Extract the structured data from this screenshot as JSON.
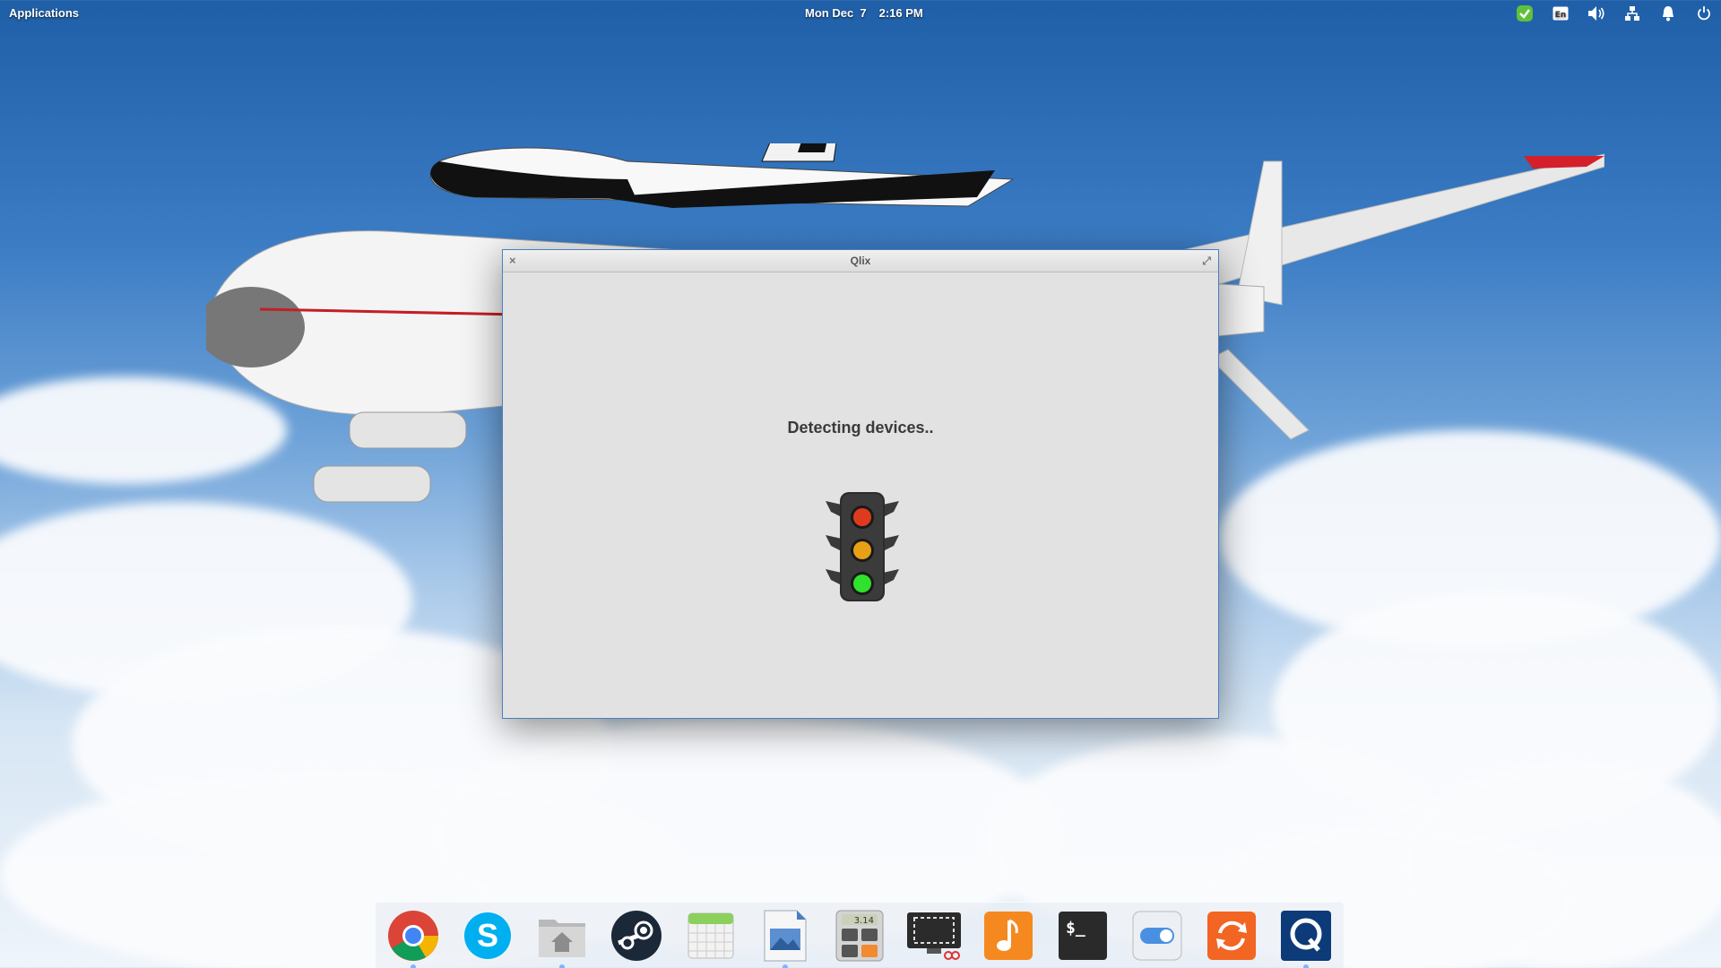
{
  "panel": {
    "applications_label": "Applications",
    "date": "Mon Dec  7",
    "time": "2:16 PM",
    "indicators": [
      "shield-check-icon",
      "keyboard-layout-icon",
      "volume-icon",
      "network-icon",
      "notifications-icon",
      "power-icon"
    ],
    "keyboard_layout": "En"
  },
  "window": {
    "title": "Qlix",
    "close_glyph": "×",
    "maximize_glyph": "⤢",
    "status_text": "Detecting devices..",
    "traffic_light_icon": "traffic-light-icon"
  },
  "dock": {
    "items": [
      {
        "name": "chrome",
        "icon": "chrome-icon",
        "running": true
      },
      {
        "name": "skype",
        "icon": "skype-icon",
        "running": false
      },
      {
        "name": "files",
        "icon": "home-folder-icon",
        "running": true
      },
      {
        "name": "steam",
        "icon": "steam-icon",
        "running": false
      },
      {
        "name": "calendar",
        "icon": "calendar-icon",
        "running": false
      },
      {
        "name": "image-viewer",
        "icon": "image-viewer-icon",
        "running": true
      },
      {
        "name": "calculator",
        "icon": "calculator-icon",
        "running": false
      },
      {
        "name": "screenshot",
        "icon": "screenshot-icon",
        "running": false
      },
      {
        "name": "music",
        "icon": "music-icon",
        "running": false
      },
      {
        "name": "terminal",
        "icon": "terminal-icon",
        "running": false
      },
      {
        "name": "switchboard",
        "icon": "settings-toggle-icon",
        "running": false
      },
      {
        "name": "updater",
        "icon": "update-icon",
        "running": false
      },
      {
        "name": "qlix",
        "icon": "qlix-icon",
        "running": true
      }
    ],
    "calculator_display": "3.14",
    "terminal_prompt": "$_"
  },
  "colors": {
    "accent": "#4a7ec2",
    "red_light": "#e03a1e",
    "amber_light": "#e8a014",
    "green_light": "#2fe22c"
  }
}
